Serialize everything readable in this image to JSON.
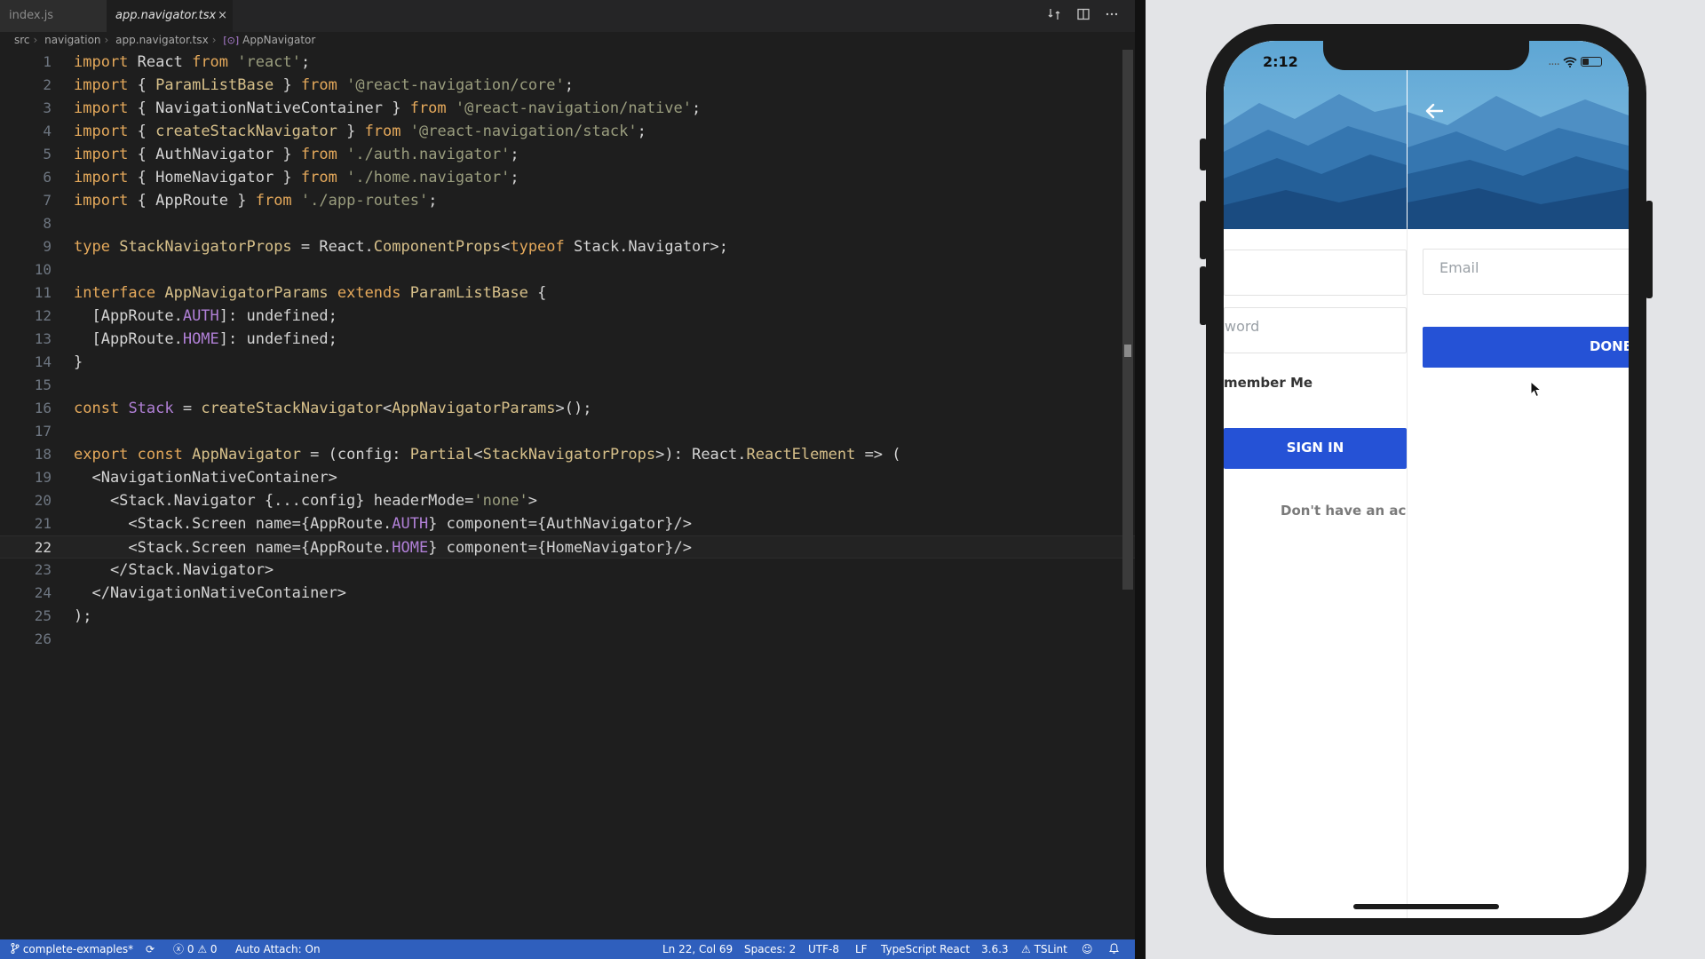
{
  "tabs": [
    {
      "label": "index.js"
    },
    {
      "label": "app.navigator.tsx",
      "close": "×"
    }
  ],
  "breadcrumb": [
    "src",
    "navigation",
    "app.navigator.tsx",
    "AppNavigator"
  ],
  "code_lines": [
    "import React from 'react';",
    "import { ParamListBase } from '@react-navigation/core';",
    "import { NavigationNativeContainer } from '@react-navigation/native';",
    "import { createStackNavigator } from '@react-navigation/stack';",
    "import { AuthNavigator } from './auth.navigator';",
    "import { HomeNavigator } from './home.navigator';",
    "import { AppRoute } from './app-routes';",
    "",
    "type StackNavigatorProps = React.ComponentProps<typeof Stack.Navigator>;",
    "",
    "interface AppNavigatorParams extends ParamListBase {",
    "  [AppRoute.AUTH]: undefined;",
    "  [AppRoute.HOME]: undefined;",
    "}",
    "",
    "const Stack = createStackNavigator<AppNavigatorParams>();",
    "",
    "export const AppNavigator = (config: Partial<StackNavigatorProps>): React.ReactElement => (",
    "  <NavigationNativeContainer>",
    "    <Stack.Navigator {...config} headerMode='none'>",
    "      <Stack.Screen name={AppRoute.AUTH} component={AuthNavigator}/>",
    "      <Stack.Screen name={AppRoute.HOME} component={HomeNavigator}/>",
    "    </Stack.Navigator>",
    "  </NavigationNativeContainer>",
    ");",
    ""
  ],
  "current_line": 22,
  "status_bar": {
    "branch": "complete-exmaples*",
    "errors": "0",
    "warnings": "0",
    "auto_attach": "Auto Attach: On",
    "position": "Ln 22, Col 69",
    "spaces": "Spaces: 2",
    "encoding": "UTF-8",
    "eol": "LF",
    "language": "TypeScript React",
    "version": "3.6.3",
    "linter": "TSLint"
  },
  "phone": {
    "time": "2:12",
    "left_screen": {
      "password_placeholder": "word",
      "remember_me": "member Me",
      "sign_in": "SIGN IN",
      "signup_prompt": "Don't have an acco"
    },
    "right_screen": {
      "email_placeholder": "Email",
      "done": "DONE"
    }
  },
  "colors": {
    "accent": "#2552d6",
    "statusbar": "#2f5fbd",
    "editor_bg": "#1e1e1e"
  }
}
